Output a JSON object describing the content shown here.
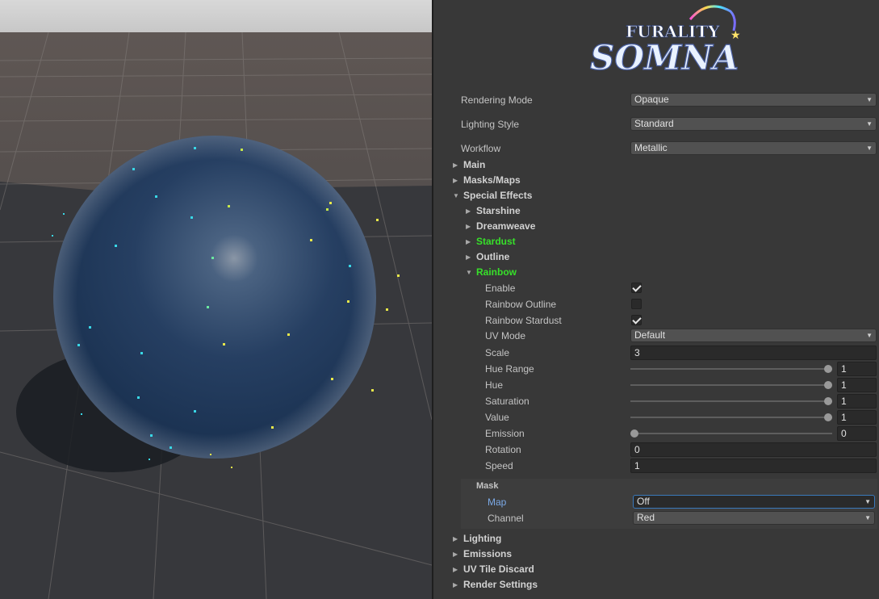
{
  "inspector": {
    "logo": {
      "line1": "FURALITY",
      "line2": "SOMNA"
    },
    "rendering_mode": {
      "label": "Rendering Mode",
      "value": "Opaque"
    },
    "lighting_style": {
      "label": "Lighting Style",
      "value": "Standard"
    },
    "workflow": {
      "label": "Workflow",
      "value": "Metallic"
    },
    "sections": {
      "main": "Main",
      "masks_maps": "Masks/Maps",
      "special_effects": "Special Effects",
      "starshine": "Starshine",
      "dreamweave": "Dreamweave",
      "stardust": "Stardust",
      "outline": "Outline",
      "rainbow": "Rainbow",
      "lighting": "Lighting",
      "emissions": "Emissions",
      "uv_tile_discard": "UV Tile Discard",
      "render_settings": "Render Settings"
    },
    "rainbow": {
      "enable": {
        "label": "Enable",
        "checked": true
      },
      "rainbow_outline": {
        "label": "Rainbow Outline",
        "checked": false
      },
      "rainbow_stardust": {
        "label": "Rainbow Stardust",
        "checked": true
      },
      "uv_mode": {
        "label": "UV Mode",
        "value": "Default"
      },
      "scale": {
        "label": "Scale",
        "value": "3"
      },
      "hue_range": {
        "label": "Hue Range",
        "value": "1",
        "fraction": 1.0
      },
      "hue": {
        "label": "Hue",
        "value": "1",
        "fraction": 1.0
      },
      "saturation": {
        "label": "Saturation",
        "value": "1",
        "fraction": 1.0
      },
      "value": {
        "label": "Value",
        "value": "1",
        "fraction": 1.0
      },
      "emission": {
        "label": "Emission",
        "value": "0",
        "fraction": 0.0
      },
      "rotation": {
        "label": "Rotation",
        "value": "0"
      },
      "speed": {
        "label": "Speed",
        "value": "1"
      },
      "mask": {
        "title": "Mask",
        "map": {
          "label": "Map",
          "value": "Off"
        },
        "channel": {
          "label": "Channel",
          "value": "Red"
        }
      }
    }
  },
  "colors": {
    "active_section": "#37e02a",
    "panel_bg": "#383838",
    "field_bg": "#2a2a2a",
    "focus_border": "#3a79bb"
  },
  "icons": {
    "collapsed": "triangle-right-icon",
    "expanded": "triangle-down-icon",
    "dropdown": "dropdown-arrow-icon",
    "check": "checkmark-icon"
  }
}
